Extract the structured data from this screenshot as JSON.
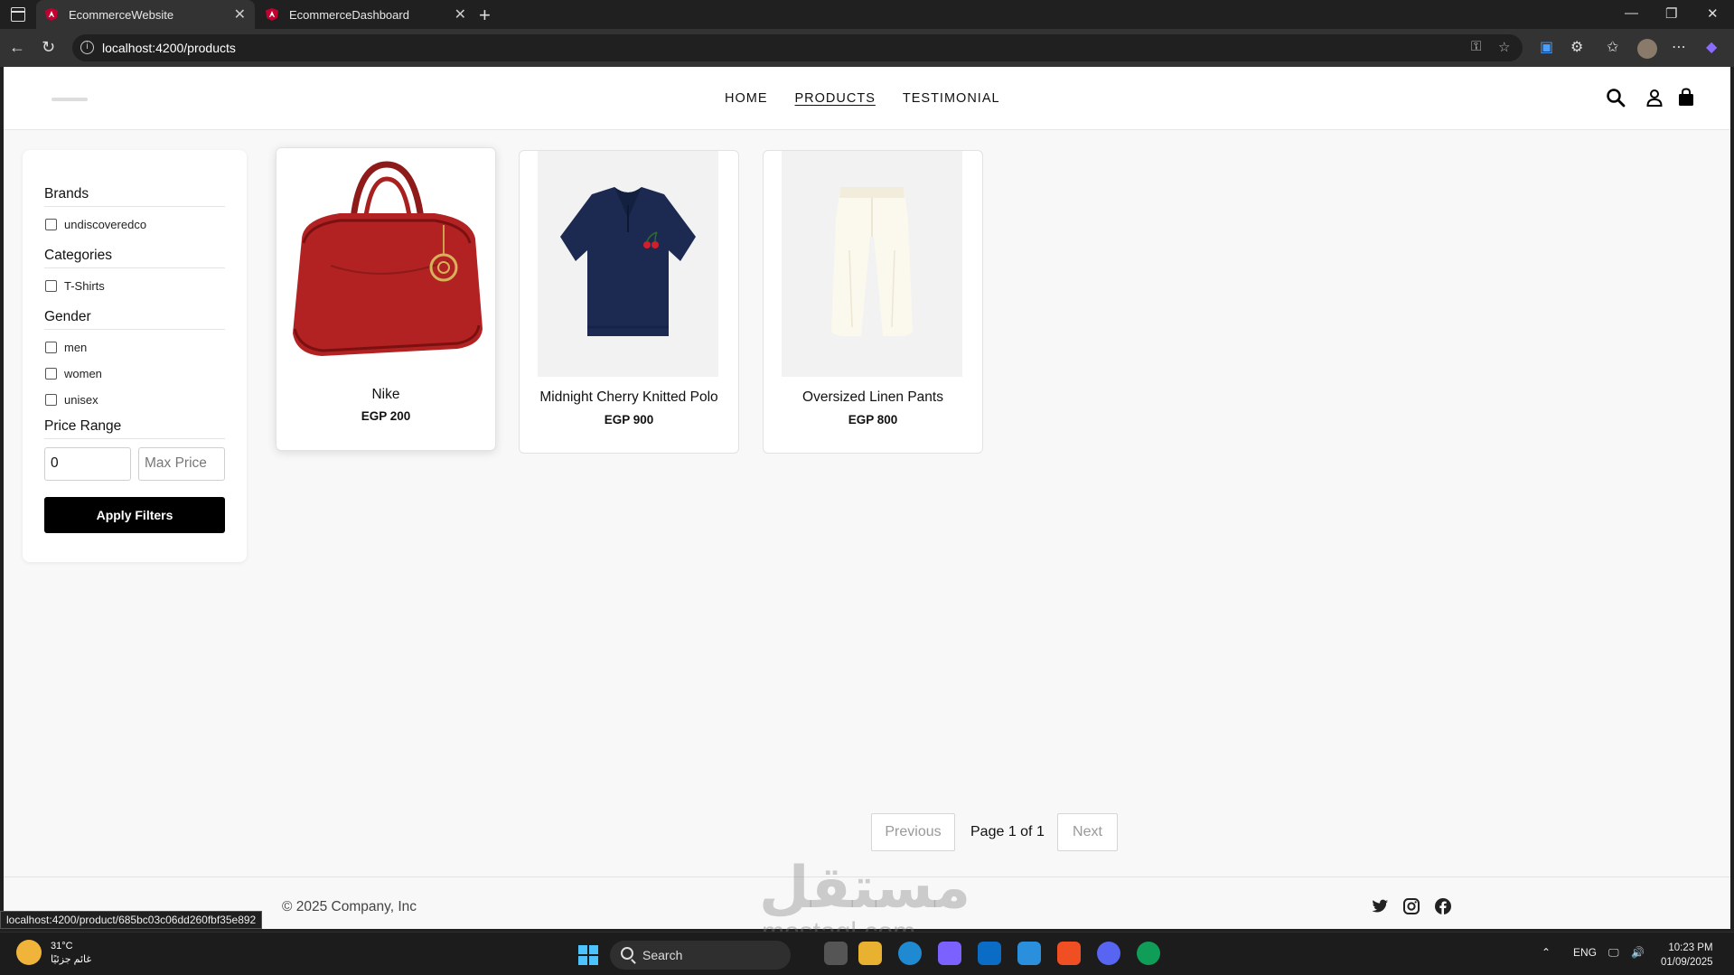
{
  "browser": {
    "tabs": [
      {
        "label": "EcommerceWebsite",
        "active": true
      },
      {
        "label": "EcommerceDashboard",
        "active": false
      }
    ],
    "url": "localhost:4200/products",
    "status_url": "localhost:4200/product/685bc03c06dd260fbf35e892"
  },
  "site": {
    "nav": [
      "HOME",
      "PRODUCTS",
      "TESTIMONIAL"
    ],
    "active_nav": "PRODUCTS"
  },
  "filters": {
    "brands_title": "Brands",
    "brands": [
      "undiscoveredco"
    ],
    "categories_title": "Categories",
    "categories": [
      "T-Shirts"
    ],
    "gender_title": "Gender",
    "genders": [
      "men",
      "women",
      "unisex"
    ],
    "price_title": "Price Range",
    "min_price_value": "0",
    "max_price_placeholder": "Max Price",
    "apply_label": "Apply Filters"
  },
  "products": [
    {
      "name": "Nike",
      "price": "EGP 200",
      "image": "red-handbag"
    },
    {
      "name": "Midnight Cherry Knitted Polo",
      "price": "EGP 900",
      "image": "navy-polo"
    },
    {
      "name": "Oversized Linen Pants",
      "price": "EGP 800",
      "image": "white-pants"
    }
  ],
  "pagination": {
    "previous": "Previous",
    "page_text": "Page 1 of 1",
    "next": "Next"
  },
  "footer": {
    "copyright": "© 2025 Company, Inc",
    "social": [
      "twitter-icon",
      "instagram-icon",
      "facebook-icon"
    ]
  },
  "watermark": {
    "arabic": "مستقل",
    "latin": "mostaql.com"
  },
  "taskbar": {
    "weather_temp": "31°C",
    "weather_desc": "غائم جزئيًا",
    "search_label": "Search",
    "lang": "ENG",
    "time": "10:23 PM",
    "date": "01/09/2025"
  },
  "colors": {
    "accent": "#000000",
    "page_bg": "#f8f8f8",
    "card_bg": "#ffffff"
  }
}
